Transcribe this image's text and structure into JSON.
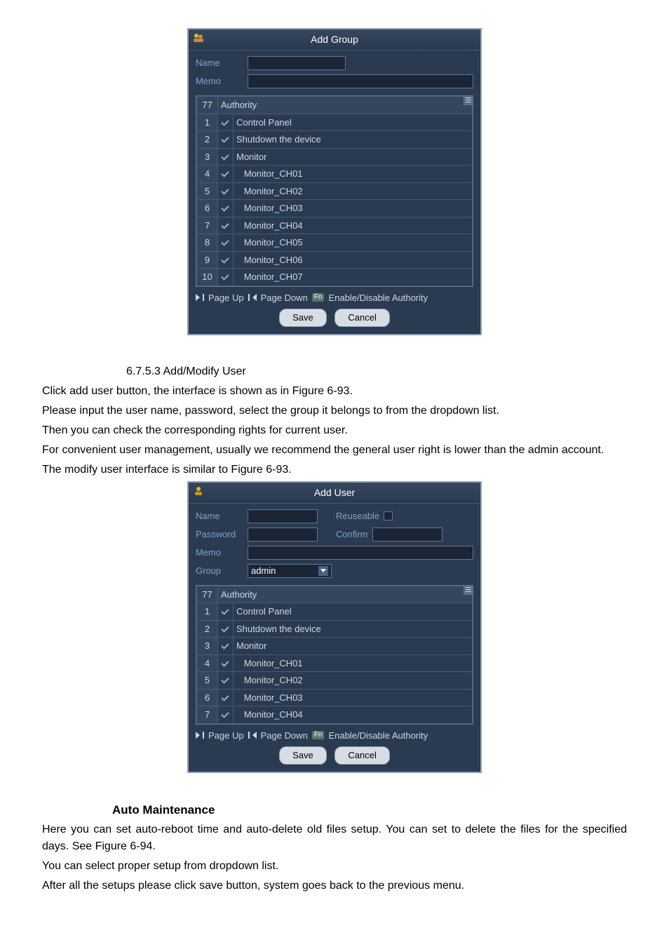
{
  "dialog1": {
    "title": "Add Group",
    "name_label": "Name",
    "memo_label": "Memo",
    "name_value": "",
    "memo_value": "",
    "count_header": "77",
    "authority_header": "Authority",
    "rows": [
      {
        "n": "1",
        "label": "Control Panel",
        "indent": false
      },
      {
        "n": "2",
        "label": "Shutdown the device",
        "indent": false
      },
      {
        "n": "3",
        "label": "Monitor",
        "indent": false
      },
      {
        "n": "4",
        "label": "Monitor_CH01",
        "indent": true
      },
      {
        "n": "5",
        "label": "Monitor_CH02",
        "indent": true
      },
      {
        "n": "6",
        "label": "Monitor_CH03",
        "indent": true
      },
      {
        "n": "7",
        "label": "Monitor_CH04",
        "indent": true
      },
      {
        "n": "8",
        "label": "Monitor_CH05",
        "indent": true
      },
      {
        "n": "9",
        "label": "Monitor_CH06",
        "indent": true
      },
      {
        "n": "10",
        "label": "Monitor_CH07",
        "indent": true
      }
    ],
    "page_up": "Page Up",
    "page_down": "Page Down",
    "fn_badge": "Fn",
    "enable_disable": "Enable/Disable Authority",
    "save": "Save",
    "cancel": "Cancel"
  },
  "section1": {
    "number": "6.7.5.3",
    "title": "Add/Modify User",
    "p1": "Click add user button, the interface is shown as in Figure 6-93.",
    "p2": "Please input the user name, password, select the group it belongs to from the dropdown list.",
    "p3": "Then you can check the corresponding rights for current user.",
    "p4": "For convenient user management, usually we recommend the general user right is lower than the admin account.",
    "p5": "The modify user interface is similar to Figure 6-93."
  },
  "dialog2": {
    "title": "Add User",
    "name_label": "Name",
    "reuse_label": "Reuseable",
    "password_label": "Password",
    "confirm_label": "Confirm",
    "memo_label": "Memo",
    "group_label": "Group",
    "group_value": "admin",
    "count_header": "77",
    "authority_header": "Authority",
    "rows": [
      {
        "n": "1",
        "label": "Control Panel",
        "indent": false
      },
      {
        "n": "2",
        "label": "Shutdown the device",
        "indent": false
      },
      {
        "n": "3",
        "label": "Monitor",
        "indent": false
      },
      {
        "n": "4",
        "label": "Monitor_CH01",
        "indent": true
      },
      {
        "n": "5",
        "label": "Monitor_CH02",
        "indent": true
      },
      {
        "n": "6",
        "label": "Monitor_CH03",
        "indent": true
      },
      {
        "n": "7",
        "label": "Monitor_CH04",
        "indent": true
      }
    ],
    "page_up": "Page Up",
    "page_down": "Page Down",
    "fn_badge": "Fn",
    "enable_disable": "Enable/Disable Authority",
    "save": "Save",
    "cancel": "Cancel"
  },
  "section2": {
    "title": "Auto Maintenance",
    "p1": "Here you can set auto-reboot time and auto-delete old files setup. You can set to delete the files for the specified days. See Figure 6-94.",
    "p2": "You can select proper setup from dropdown list.",
    "p3": "After all the setups please click save button, system goes back to the previous menu."
  }
}
